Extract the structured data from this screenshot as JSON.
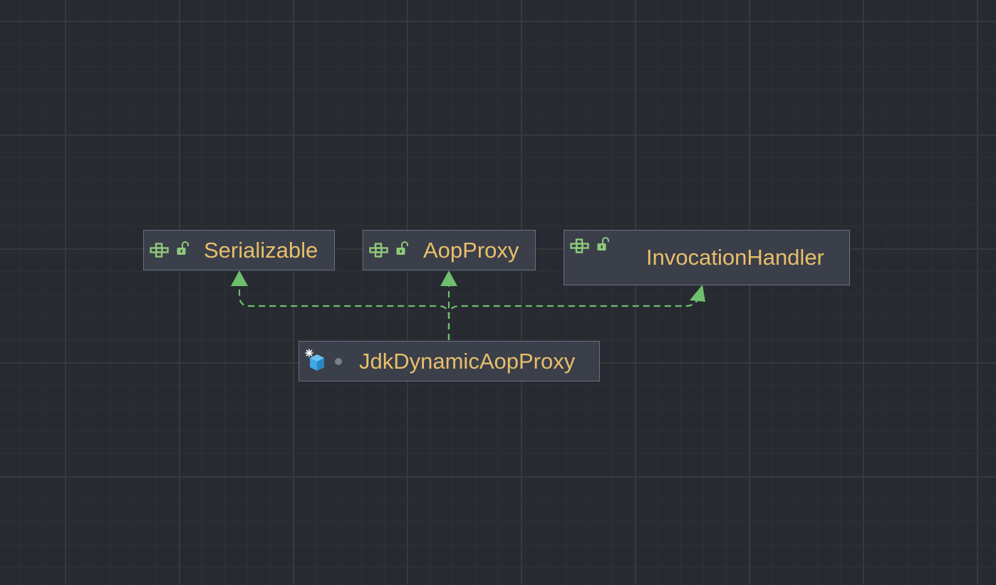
{
  "diagram": {
    "type": "class-hierarchy",
    "nodes": [
      {
        "id": "serializable",
        "label": "Serializable",
        "kind": "interface",
        "icon": "interface-icon",
        "access_icon": "unlocked-icon"
      },
      {
        "id": "aopproxy",
        "label": "AopProxy",
        "kind": "interface",
        "icon": "interface-icon",
        "access_icon": "unlocked-icon"
      },
      {
        "id": "invocationhandler",
        "label": "InvocationHandler",
        "kind": "interface",
        "icon": "interface-icon",
        "access_icon": "unlocked-icon"
      },
      {
        "id": "jdkdynamicaopproxy",
        "label": "JdkDynamicAopProxy",
        "kind": "final-class",
        "icon": "class-cube-icon",
        "access_icon": "package-private-dot-icon"
      }
    ],
    "edges": [
      {
        "from": "jdkdynamicaopproxy",
        "to": "serializable",
        "style": "dashed",
        "relation": "implements"
      },
      {
        "from": "jdkdynamicaopproxy",
        "to": "aopproxy",
        "style": "dashed",
        "relation": "implements"
      },
      {
        "from": "jdkdynamicaopproxy",
        "to": "invocationhandler",
        "style": "dashed",
        "relation": "implements"
      }
    ],
    "colors": {
      "background": "#272a31",
      "node_fill": "#3b3f4a",
      "node_border": "#697080",
      "label": "#e8bf6a",
      "edge": "#6fbf6f",
      "interface_icon": "#8fca7a",
      "class_icon": "#3fa5e6"
    }
  }
}
